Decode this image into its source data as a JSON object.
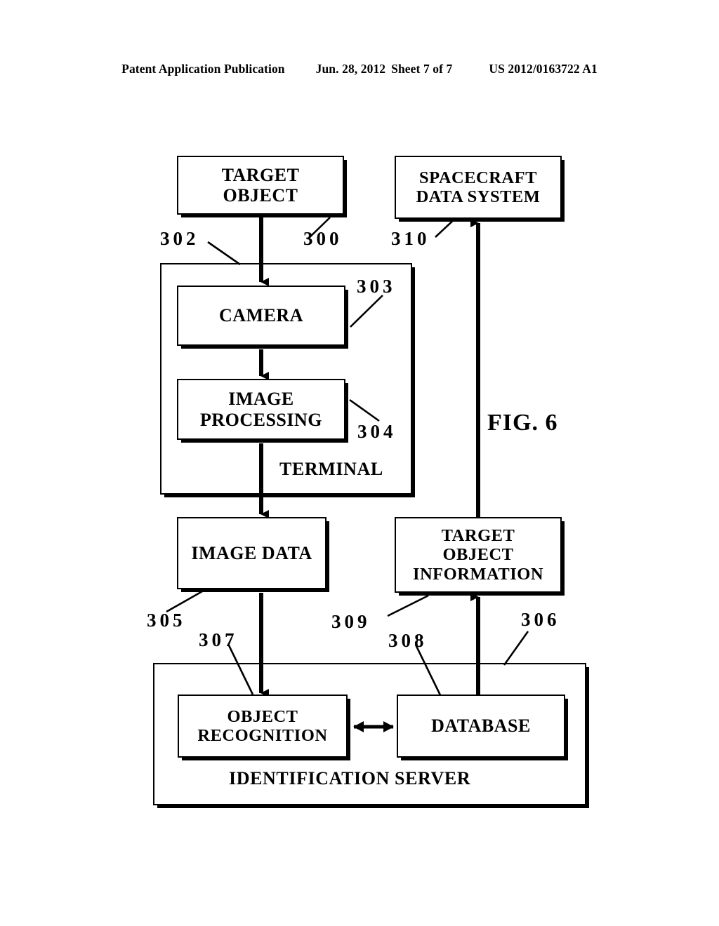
{
  "header": {
    "publication": "Patent Application Publication",
    "date": "Jun. 28, 2012",
    "sheet": "Sheet 7 of 7",
    "patent_number": "US 2012/0163722 A1"
  },
  "figure": {
    "caption": "FIG. 6",
    "type": "block-diagram",
    "blocks": [
      {
        "id": "300",
        "label": "TARGET\nOBJECT",
        "line1": "TARGET",
        "line2": "OBJECT"
      },
      {
        "id": "310",
        "label": "SPACECRAFT\nDATA SYSTEM",
        "line1": "SPACECRAFT",
        "line2": "DATA SYSTEM"
      },
      {
        "id": "303",
        "label": "CAMERA",
        "line1": "CAMERA"
      },
      {
        "id": "304",
        "label": "IMAGE\nPROCESSING",
        "line1": "IMAGE",
        "line2": "PROCESSING"
      },
      {
        "id": "302",
        "label": "TERMINAL",
        "line1": "TERMINAL"
      },
      {
        "id": "305",
        "label": "IMAGE  DATA",
        "line1": "IMAGE  DATA"
      },
      {
        "id": "309",
        "label": "TARGET\nOBJECT\nINFORMATION",
        "line1": "TARGET",
        "line2": "OBJECT",
        "line3": "INFORMATION"
      },
      {
        "id": "307",
        "label": "OBJECT\nRECOGNITION",
        "line1": "OBJECT",
        "line2": "RECOGNITION"
      },
      {
        "id": "308",
        "label": "DATABASE",
        "line1": "DATABASE"
      },
      {
        "id": "306",
        "label": "IDENTIFICATION  SERVER",
        "line1": "IDENTIFICATION  SERVER"
      }
    ],
    "reference_numerals": [
      "300",
      "302",
      "303",
      "304",
      "305",
      "306",
      "307",
      "308",
      "309",
      "310"
    ],
    "connections": [
      {
        "from": "300",
        "to": "303",
        "style": "arrow-down",
        "description": "target object to camera"
      },
      {
        "from": "303",
        "to": "304",
        "style": "arrow-down",
        "description": "camera to image processing"
      },
      {
        "from": "304",
        "to": "305",
        "style": "arrow-down",
        "description": "image processing to image data"
      },
      {
        "from": "305",
        "to": "307",
        "style": "arrow-down",
        "description": "image data to object recognition"
      },
      {
        "from": "307",
        "to": "308",
        "style": "double-arrow",
        "description": "object recognition to database"
      },
      {
        "from": "308",
        "to": "309",
        "style": "arrow-up",
        "description": "database to target object information"
      },
      {
        "from": "309",
        "to": "310",
        "style": "arrow-up",
        "description": "target object information to spacecraft data system"
      }
    ]
  },
  "boxes": {
    "target_object": {
      "line1": "TARGET",
      "line2": "OBJECT"
    },
    "spacecraft": {
      "line1": "SPACECRAFT",
      "line2": "DATA SYSTEM"
    },
    "camera": {
      "line1": "CAMERA"
    },
    "image_processing": {
      "line1": "IMAGE",
      "line2": "PROCESSING"
    },
    "terminal": {
      "label": "TERMINAL"
    },
    "image_data": {
      "line1": "IMAGE  DATA"
    },
    "target_object_info": {
      "line1": "TARGET",
      "line2": "OBJECT",
      "line3": "INFORMATION"
    },
    "object_recognition": {
      "line1": "OBJECT",
      "line2": "RECOGNITION"
    },
    "database": {
      "line1": "DATABASE"
    },
    "identification_server": {
      "label": "IDENTIFICATION  SERVER"
    }
  },
  "refs": {
    "n300": "300",
    "n302": "302",
    "n303": "303",
    "n304": "304",
    "n305": "305",
    "n306": "306",
    "n307": "307",
    "n308": "308",
    "n309": "309",
    "n310": "310"
  },
  "colors": {
    "ink": "#000000",
    "paper": "#ffffff"
  }
}
